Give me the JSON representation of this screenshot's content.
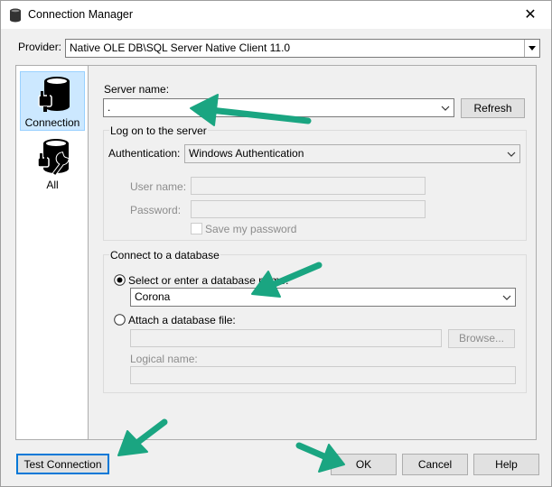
{
  "window": {
    "title": "Connection Manager",
    "close_glyph": "✕"
  },
  "provider": {
    "label": "Provider:",
    "value": "Native OLE DB\\SQL Server Native Client 11.0"
  },
  "nav": {
    "items": [
      {
        "label": "Connection",
        "icon": "database-plug-icon",
        "selected": true
      },
      {
        "label": "All",
        "icon": "database-wrench-icon",
        "selected": false
      }
    ]
  },
  "server": {
    "label": "Server name:",
    "value": ".",
    "refresh_label": "Refresh"
  },
  "logon": {
    "group_title": "Log on to the server",
    "auth_label": "Authentication:",
    "auth_value": "Windows Authentication",
    "username_label": "User name:",
    "password_label": "Password:",
    "save_password_label": "Save my password"
  },
  "database": {
    "group_title": "Connect to a database",
    "select_label": "Select or enter a database name:",
    "select_value": "Corona",
    "attach_label": "Attach a database file:",
    "browse_label": "Browse...",
    "logical_label": "Logical name:"
  },
  "footer": {
    "test_label": "Test Connection",
    "ok_label": "OK",
    "cancel_label": "Cancel",
    "help_label": "Help"
  },
  "colors": {
    "accent": "#0078d7",
    "arrow": "#1aa581",
    "selection": "#cce8ff"
  }
}
